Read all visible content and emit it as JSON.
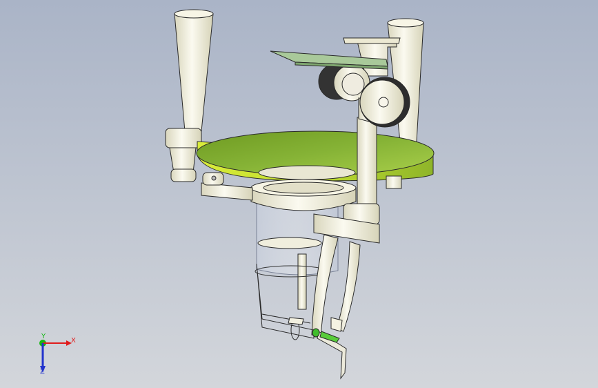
{
  "viewport": {
    "background_top": "#aab4c7",
    "background_bottom": "#d3d6db"
  },
  "model": {
    "part_color_white": "#f4f2dc",
    "part_color_green": "#86b336",
    "part_color_board": "#a9c99a",
    "edge_color": "#2a2a2a"
  },
  "triad": {
    "x_label": "X",
    "y_label": "Y",
    "z_label": "Z",
    "x_color": "#e01b1b",
    "y_color": "#14b814",
    "z_color": "#2233cc"
  }
}
